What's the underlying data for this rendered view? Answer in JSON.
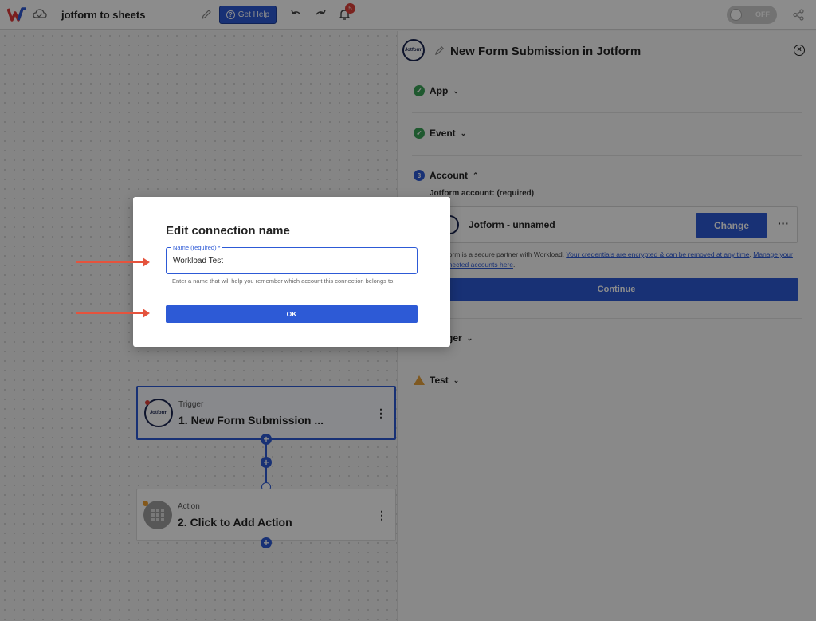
{
  "topbar": {
    "workflow_title": "jotform to sheets",
    "get_help_label": "Get Help",
    "notification_count": "5",
    "toggle_label": "OFF"
  },
  "panel": {
    "logo_text": "Jotform",
    "title": "New Form Submission in Jotform",
    "close_glyph": "×",
    "steps": {
      "app": "App",
      "event": "Event",
      "account": "Account",
      "account_number": "3",
      "trigger": "Trigger",
      "test": "Test"
    },
    "account_field_label": "Jotform account: (required)",
    "account_name": "Jotform - unnamed",
    "change_label": "Change",
    "more_glyph": "···",
    "note_prefix": "Jotform is a secure partner with Workload. ",
    "note_link1": "Your credentials are encrypted & can be removed at any time",
    "note_middle": ". ",
    "note_link2": "Manage your connected accounts here",
    "note_suffix": ".",
    "continue_label": "Continue"
  },
  "canvas": {
    "trigger_node": {
      "type": "Trigger",
      "title": "1. New Form Submission ...",
      "logo_text": "Jotform"
    },
    "action_node": {
      "type": "Action",
      "title": "2. Click to Add Action"
    },
    "menu_glyph": "⋮",
    "plus_glyph": "+"
  },
  "modal": {
    "title": "Edit connection name",
    "field_label": "Name (required) *",
    "field_value": "Workload Test",
    "help_text": "Enter a name that will help you remember which account this connection belongs to.",
    "ok_label": "OK"
  },
  "colors": {
    "primary": "#2d5ad6",
    "annotation_arrow": "#e5533d",
    "success": "#3aa357",
    "warning": "#e8a33c"
  }
}
